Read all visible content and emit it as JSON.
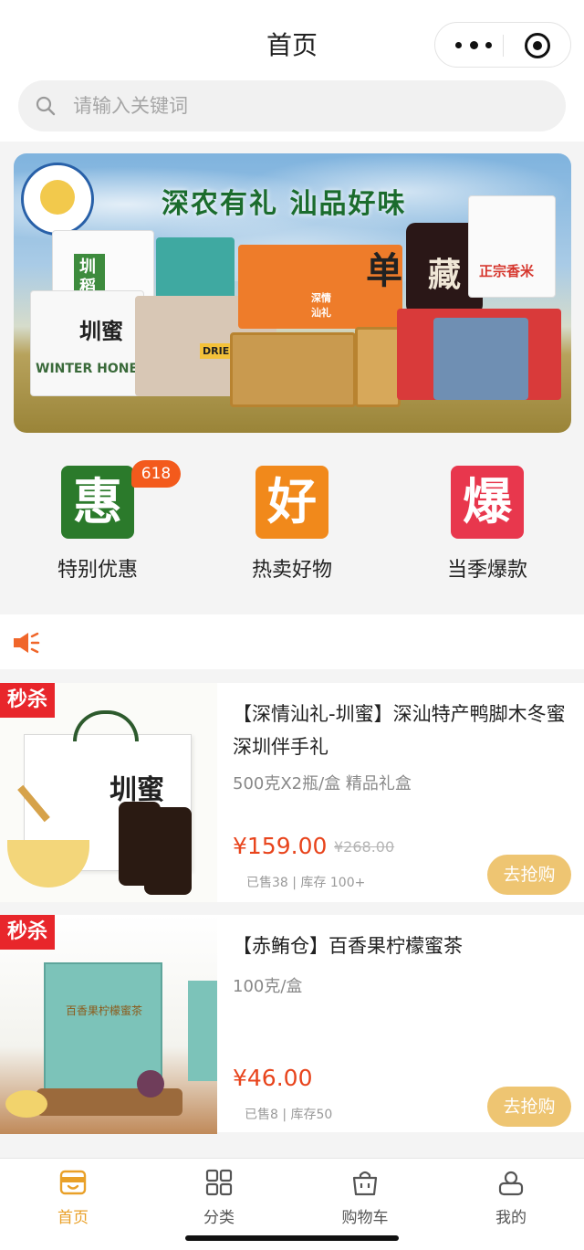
{
  "header": {
    "title": "首页",
    "search_placeholder": "请输入关键词"
  },
  "banner": {
    "slogan": "深农有礼 汕品好味",
    "product_labels": [
      "圳稻",
      "圳蜜",
      "WINTER HONEY",
      "深情汕礼",
      "单",
      "藏",
      "正宗香米",
      "DRIED SQUID"
    ]
  },
  "categories": [
    {
      "tile": "惠",
      "label": "特别优惠",
      "color": "#2b7a2b",
      "badge": "618"
    },
    {
      "tile": "好",
      "label": "热卖好物",
      "color": "#f1891b"
    },
    {
      "tile": "爆",
      "label": "当季爆款",
      "color": "#e8374d"
    }
  ],
  "products": [
    {
      "flash": "秒杀",
      "title": "【深情汕礼-圳蜜】深汕特产鸭脚木冬蜜 深圳伴手礼",
      "spec": "500克X2瓶/盒 精品礼盒",
      "price": "¥159.00",
      "original_price": "¥268.00",
      "meta": "已售38 | 库存 100+",
      "buy": "去抢购",
      "image_text": "圳蜜"
    },
    {
      "flash": "秒杀",
      "title": "【赤鲔仓】百香果柠檬蜜茶",
      "spec": "100克/盒",
      "price": "¥46.00",
      "meta": "已售8 | 库存50",
      "buy": "去抢购",
      "image_text": "百香果柠檬蜜茶"
    }
  ],
  "tabbar": [
    {
      "label": "首页",
      "icon": "home-bag-icon",
      "active": true
    },
    {
      "label": "分类",
      "icon": "grid-icon"
    },
    {
      "label": "购物车",
      "icon": "cart-icon"
    },
    {
      "label": "我的",
      "icon": "user-icon"
    }
  ],
  "colors": {
    "accent": "#e9a028",
    "price": "#e8441c",
    "flash": "#e8262b",
    "buy_button": "#eec572"
  }
}
